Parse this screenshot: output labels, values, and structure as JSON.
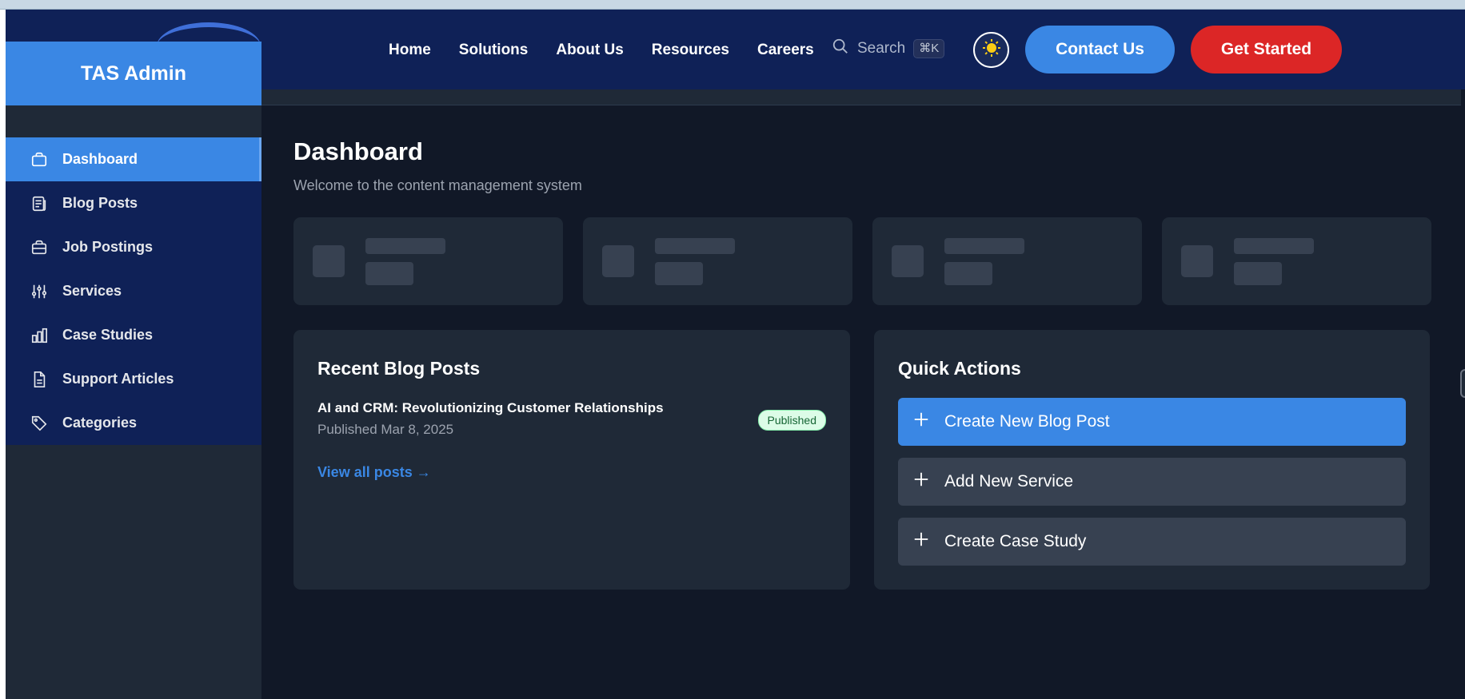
{
  "topnav": {
    "links": [
      "Home",
      "Solutions",
      "About Us",
      "Resources",
      "Careers"
    ],
    "search_label": "Search",
    "search_shortcut": "⌘K",
    "contact_label": "Contact Us",
    "get_started_label": "Get Started"
  },
  "sidebar": {
    "brand": "TAS Admin",
    "items": [
      {
        "label": "Dashboard",
        "icon": "briefcase-icon",
        "active": true
      },
      {
        "label": "Blog Posts",
        "icon": "newspaper-icon",
        "active": false
      },
      {
        "label": "Job Postings",
        "icon": "briefcase-alt-icon",
        "active": false
      },
      {
        "label": "Services",
        "icon": "sliders-icon",
        "active": false
      },
      {
        "label": "Case Studies",
        "icon": "bar-chart-icon",
        "active": false
      },
      {
        "label": "Support Articles",
        "icon": "document-icon",
        "active": false
      },
      {
        "label": "Categories",
        "icon": "tag-icon",
        "active": false
      }
    ]
  },
  "main": {
    "title": "Dashboard",
    "subtitle": "Welcome to the content management system",
    "recent_posts": {
      "title": "Recent Blog Posts",
      "posts": [
        {
          "title": "AI and CRM: Revolutionizing Customer Relationships",
          "meta": "Published Mar 8, 2025",
          "status": "Published"
        }
      ],
      "view_all": "View all posts →"
    },
    "quick_actions": {
      "title": "Quick Actions",
      "actions": [
        "Create New Blog Post",
        "Add New Service",
        "Create Case Study"
      ]
    }
  },
  "colors": {
    "accent": "#3a87e4",
    "danger": "#dc2626",
    "nav_bg": "#0f2157",
    "page_bg": "#111827",
    "card_bg": "#1f2937"
  }
}
